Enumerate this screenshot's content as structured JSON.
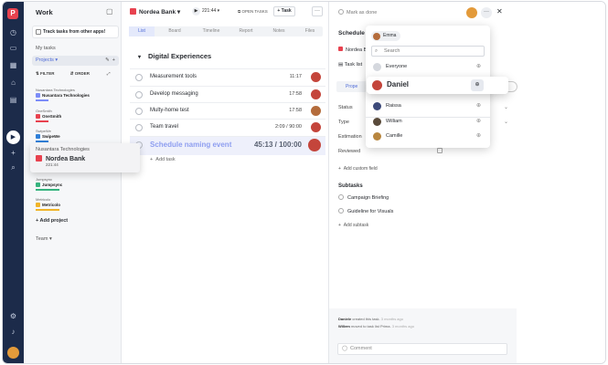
{
  "sidebar": {
    "title": "Work",
    "track_text": "Track tasks from other apps!",
    "my_tasks": "My tasks",
    "projects": "Projects",
    "filter": "FILTER",
    "order": "ORDER",
    "projects_list": [
      {
        "org": "Nusantara Technologies",
        "name": "Nusantara Technologies",
        "color": "#7c8cf8"
      },
      {
        "org": "OneSmith",
        "name": "OneSmith",
        "color": "#e8424f"
      },
      {
        "org": "SwipeWe",
        "name": "SwipeWe",
        "color": "#2f7fd8"
      },
      {
        "org": "Jumpsync",
        "name": "Jumpsync",
        "color": "#36b37e"
      },
      {
        "org": "Metricolo",
        "name": "Metricolo",
        "color": "#f0b429"
      }
    ],
    "add_project": "Add project",
    "team": "Team"
  },
  "drag_card": {
    "org": "Nusantara Technologies",
    "name": "Nordea Bank",
    "time": "221:44"
  },
  "main": {
    "project": "Nordea Bank",
    "timer": "221:44",
    "open_tasks": "OPEN TASKS",
    "task_button": "+ Task",
    "more": "···",
    "tabs": [
      "List",
      "Board",
      "Timeline",
      "Report",
      "Notes",
      "Files"
    ],
    "group": "Digital Experiences",
    "tasks": [
      {
        "name": "Measurement tools",
        "time": "11:17",
        "avatar": "#c4453b"
      },
      {
        "name": "Develop messaging",
        "time": "17:58",
        "avatar": "#c4453b"
      },
      {
        "name": "Multy-home test",
        "time": "17:58",
        "avatar": "#b46c3c"
      },
      {
        "name": "Team travel",
        "time": "2:09 / 90:00",
        "avatar": "#c4453b"
      },
      {
        "name": "Schedule naming event",
        "time": "45:13 / 100:00",
        "avatar": "#c4453b"
      }
    ],
    "add_task": "Add task"
  },
  "detail": {
    "mark_done": "Mark as done",
    "title": "Schedule N",
    "project": "Nordea B",
    "task_list": "Task list",
    "tab": "Prope",
    "fields": [
      "Status",
      "Type",
      "Estimation",
      "Reviewed"
    ],
    "add_custom_field": "Add custom field",
    "subtasks": "Subtasks",
    "subtask_items": [
      "Campaign Briefing",
      "Guideline for Visuals"
    ],
    "add_subtask": "Add subtask",
    "activity": [
      {
        "who": "Daniele",
        "what": "created this task.",
        "when": "3 months ago"
      },
      {
        "who": "Willem",
        "what": "moved to task list Prima.",
        "when": "3 months ago"
      }
    ],
    "comment_placeholder": "Comment"
  },
  "assignee_dropdown": {
    "selected": "Emma",
    "search_placeholder": "Search",
    "everyone": "Everyone",
    "people": [
      {
        "name": "Raissa",
        "color": "#3d4a7a"
      },
      {
        "name": "William",
        "color": "#5a4b3b"
      },
      {
        "name": "Camille",
        "color": "#b8863f"
      }
    ],
    "highlighted": "Daniel"
  },
  "colors": {
    "accent": "#4f6bd8",
    "brand": "#e8424f",
    "rail": "#1c2b4a"
  }
}
